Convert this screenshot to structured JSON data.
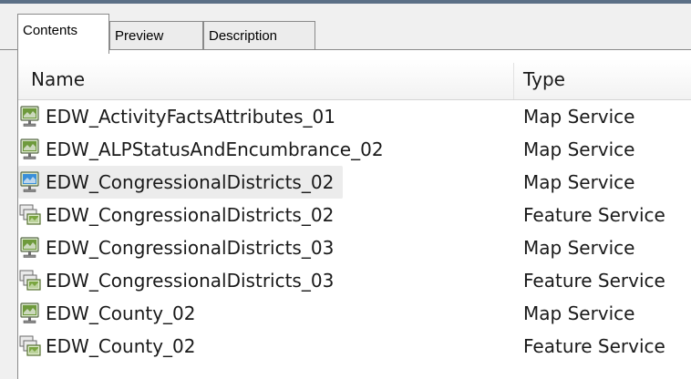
{
  "tabs": [
    {
      "label": "Contents",
      "active": true
    },
    {
      "label": "Preview",
      "active": false
    },
    {
      "label": "Description",
      "active": false
    }
  ],
  "columns": {
    "name": "Name",
    "type": "Type"
  },
  "rows": [
    {
      "name": "EDW_ActivityFactsAttributes_01",
      "type": "Map Service",
      "icon": "map-service-icon",
      "selected": false
    },
    {
      "name": "EDW_ALPStatusAndEncumbrance_02",
      "type": "Map Service",
      "icon": "map-service-icon",
      "selected": false
    },
    {
      "name": "EDW_CongressionalDistricts_02",
      "type": "Map Service",
      "icon": "map-service-icon",
      "selected": true
    },
    {
      "name": "EDW_CongressionalDistricts_02",
      "type": "Feature Service",
      "icon": "feature-service-icon",
      "selected": false
    },
    {
      "name": "EDW_CongressionalDistricts_03",
      "type": "Map Service",
      "icon": "map-service-icon",
      "selected": false
    },
    {
      "name": "EDW_CongressionalDistricts_03",
      "type": "Feature Service",
      "icon": "feature-service-icon",
      "selected": false
    },
    {
      "name": "EDW_County_02",
      "type": "Map Service",
      "icon": "map-service-icon",
      "selected": false
    },
    {
      "name": "EDW_County_02",
      "type": "Feature Service",
      "icon": "feature-service-icon",
      "selected": false
    }
  ],
  "colors": {
    "selected_row_bg": "#ececec",
    "selected_icon_accent": "#3a8fd9",
    "map_icon_accent": "#6e9a3c"
  }
}
